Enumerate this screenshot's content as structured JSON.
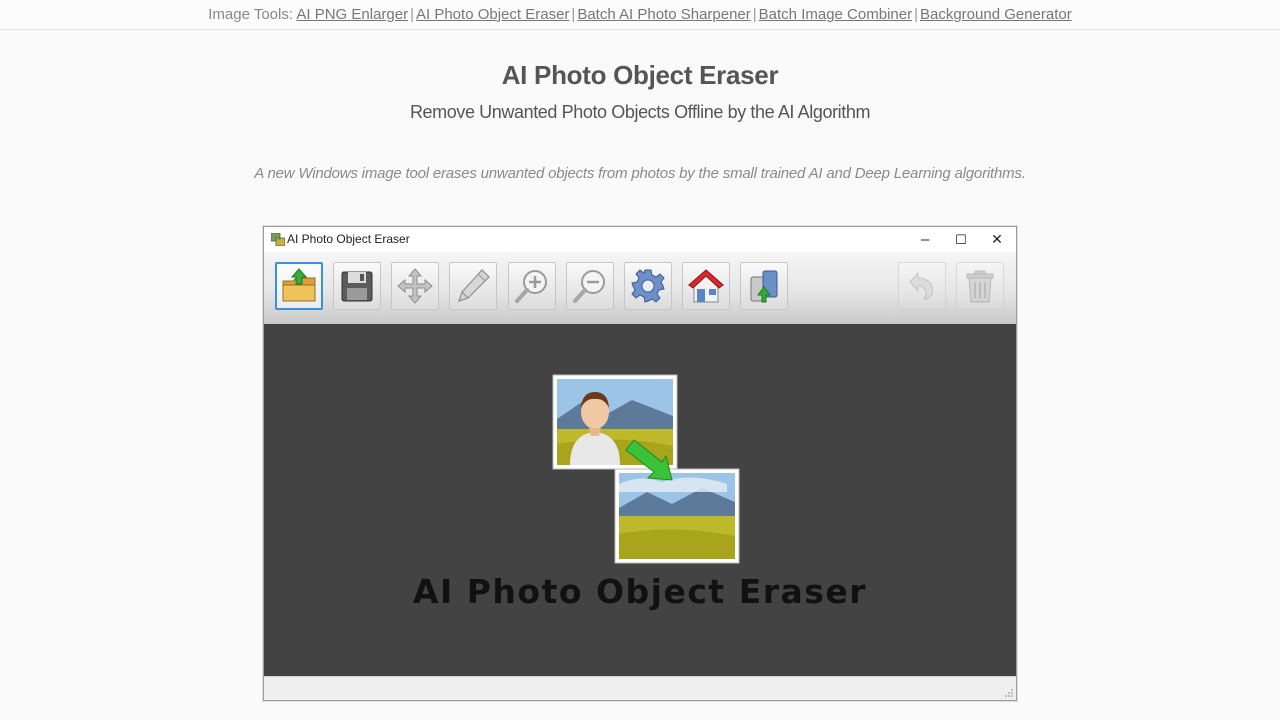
{
  "nav": {
    "prefix": "Image Tools:",
    "links": [
      "AI PNG Enlarger",
      "AI Photo Object Eraser",
      "Batch AI Photo Sharpener",
      "Batch Image Combiner",
      "Background Generator"
    ],
    "separator": "|"
  },
  "page": {
    "title": "AI Photo Object Eraser",
    "subtitle": "Remove Unwanted Photo Objects Offline by the AI Algorithm",
    "lead": "A new Windows image tool erases unwanted objects from photos by the small trained AI and Deep Learning algorithms."
  },
  "window": {
    "title": "AI Photo Object Eraser",
    "controls": {
      "minimize": "–",
      "maximize": "☐",
      "close": "✕"
    },
    "toolbar": {
      "buttons": [
        "open-folder-icon",
        "save-icon",
        "move-icon",
        "eraser-pen-icon",
        "zoom-in-icon",
        "zoom-out-icon",
        "settings-gear-icon",
        "home-icon",
        "export-icon",
        "undo-icon",
        "trash-icon"
      ]
    },
    "splash_text": "AI Photo Object Eraser"
  },
  "colors": {
    "canvas": "#434343",
    "accent": "#3c8fd8",
    "link": "#777777"
  }
}
